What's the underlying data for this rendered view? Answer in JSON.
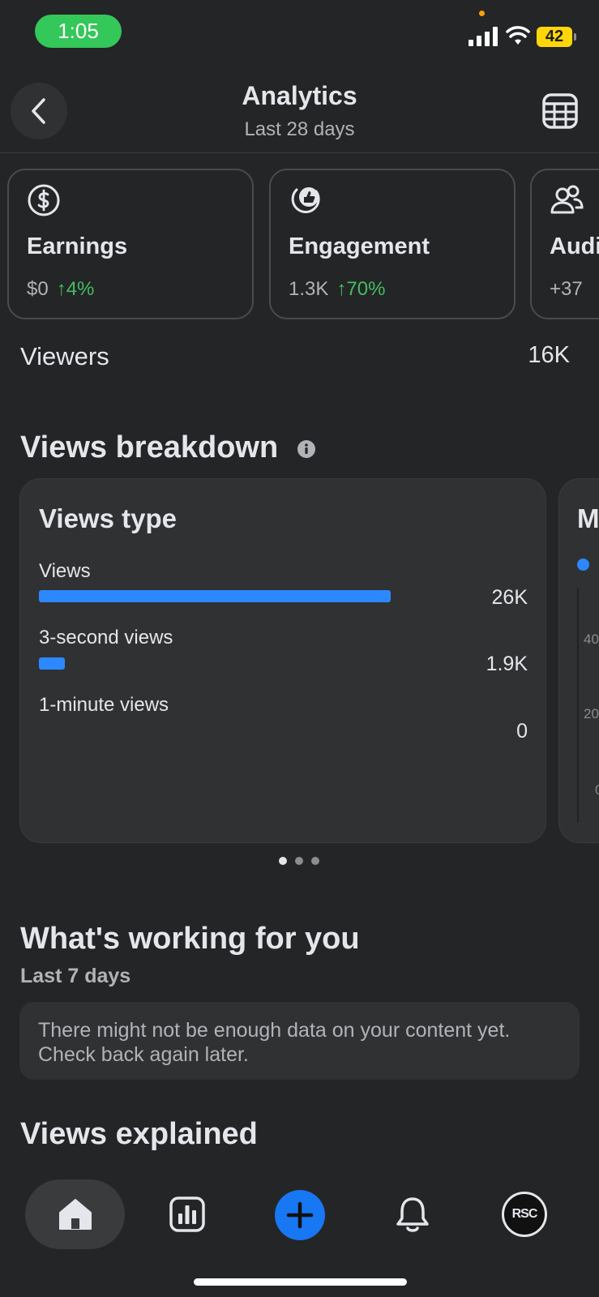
{
  "status_bar": {
    "time": "1:05",
    "battery": "42"
  },
  "header": {
    "title": "Analytics",
    "subtitle": "Last 28 days"
  },
  "metrics": [
    {
      "title": "Earnings",
      "value": "$0",
      "change": "↑4%"
    },
    {
      "title": "Engagement",
      "value": "1.3K",
      "change": "↑70%"
    },
    {
      "title": "Audi",
      "value": "+37"
    }
  ],
  "viewers": {
    "label": "Viewers",
    "value": "16K"
  },
  "views_breakdown": {
    "title": "Views breakdown",
    "card_title": "Views type",
    "rows": [
      {
        "label": "Views",
        "value": "26K",
        "fraction": 1.0
      },
      {
        "label": "3-second views",
        "value": "1.9K",
        "fraction": 0.073
      },
      {
        "label": "1-minute views",
        "value": "0",
        "fraction": 0
      }
    ],
    "next_card": {
      "title_fragment": "M",
      "tick_labels": [
        "40",
        "20",
        "0"
      ],
      "legend_color": "#2d88ff"
    },
    "pager": {
      "total": 3,
      "active": 0
    }
  },
  "whats_working": {
    "title": "What's working for you",
    "period": "Last 7 days",
    "message": "There might not be enough data on your content yet. Check back again later."
  },
  "views_explained": {
    "title": "Views explained"
  },
  "nav": {
    "avatar_text": "RSC"
  },
  "colors": {
    "accent": "#1877f2",
    "bar": "#2d88ff",
    "positive": "#45bd62",
    "background": "#242526"
  }
}
